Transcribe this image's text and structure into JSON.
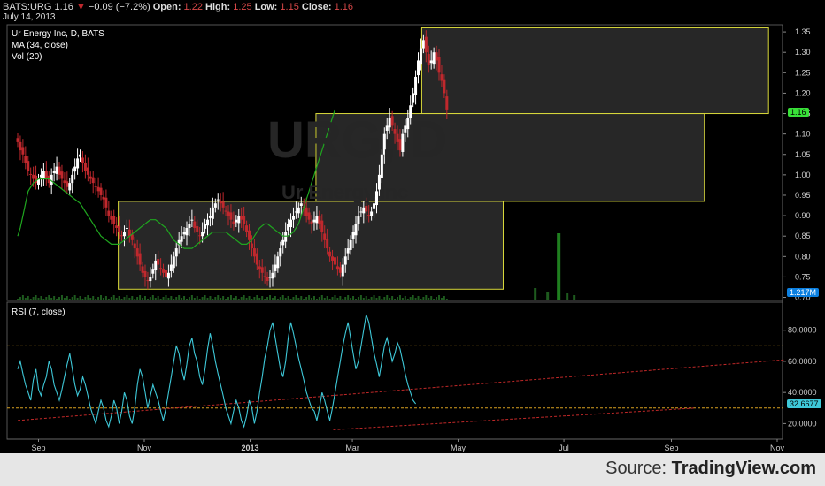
{
  "header": {
    "symbol": "BATS:URG",
    "last": "1.16",
    "change": "−0.09 (−7.2%)",
    "open_label": "Open:",
    "open": "1.22",
    "high_label": "High:",
    "high": "1.25",
    "low_label": "Low:",
    "low": "1.15",
    "close_label": "Close:",
    "close": "1.16",
    "date": "July 14, 2013"
  },
  "legend": {
    "title": "Ur Energy Inc, D, BATS",
    "ma": "MA (34, close)",
    "vol": "Vol (20)",
    "rsi": "RSI (7, close)"
  },
  "watermark": {
    "symbol": "URG, D",
    "name": "Ur Energy Inc"
  },
  "source": {
    "prefix": "Source: ",
    "brand": "TradingView.com"
  },
  "colors": {
    "up": "#ffffff",
    "down": "#c0282d",
    "ma": "#1fa61f",
    "rsi": "#3ec8d8",
    "box": "#d8d83a",
    "level": "#d8a020",
    "trend": "#c02828",
    "price_tag": "#38e038",
    "vol_tag": "#0b7fe0"
  },
  "chart_data": {
    "type": "candlestick",
    "price_axis": {
      "ticks": [
        "0.70",
        "0.75",
        "0.80",
        "0.85",
        "0.90",
        "0.95",
        "1.00",
        "1.05",
        "1.10",
        "1.15",
        "1.20",
        "1.25",
        "1.30",
        "1.35"
      ],
      "last_price": "1.16"
    },
    "volume": {
      "last": "1.217M",
      "spike_value_fraction": 0.95
    },
    "time_axis": {
      "ticks": [
        "Sep",
        "Nov",
        "2013",
        "Mar",
        "May",
        "Jul",
        "Sep",
        "Nov"
      ]
    },
    "rsi": {
      "ticks": [
        "20.0000",
        "40.0000",
        "60.0000",
        "80.0000"
      ],
      "last": "32.6677",
      "levels": [
        70,
        30
      ]
    },
    "boxes": [
      {
        "x_start": "2012-10-17",
        "x_end": "2013-05-27",
        "low": 0.72,
        "high": 0.935
      },
      {
        "x_start": "2013-02-08",
        "x_end": "2013-09-20",
        "low": 0.935,
        "high": 1.15
      },
      {
        "x_start": "2013-04-10",
        "x_end": "2013-10-27",
        "low": 1.15,
        "high": 1.36
      }
    ],
    "price_series": {
      "x_start": "2012-08-20",
      "step_days": 1.5,
      "closes": [
        1.08,
        1.06,
        1.05,
        1.03,
        1.01,
        1.0,
        0.99,
        0.98,
        0.99,
        1.0,
        1.01,
        0.99,
        0.98,
        1.0,
        1.01,
        1.02,
        1.0,
        0.99,
        0.98,
        0.97,
        0.98,
        1.0,
        1.02,
        1.04,
        1.05,
        1.03,
        1.01,
        1.0,
        0.99,
        0.98,
        0.97,
        0.96,
        0.95,
        0.94,
        0.92,
        0.9,
        0.89,
        0.88,
        0.87,
        0.86,
        0.85,
        0.86,
        0.87,
        0.85,
        0.84,
        0.82,
        0.8,
        0.78,
        0.76,
        0.75,
        0.74,
        0.75,
        0.77,
        0.79,
        0.78,
        0.77,
        0.76,
        0.75,
        0.76,
        0.78,
        0.8,
        0.82,
        0.84,
        0.85,
        0.86,
        0.87,
        0.88,
        0.89,
        0.87,
        0.86,
        0.85,
        0.86,
        0.88,
        0.89,
        0.9,
        0.92,
        0.93,
        0.94,
        0.93,
        0.92,
        0.91,
        0.9,
        0.89,
        0.88,
        0.89,
        0.9,
        0.89,
        0.88,
        0.86,
        0.84,
        0.82,
        0.8,
        0.78,
        0.77,
        0.76,
        0.75,
        0.74,
        0.75,
        0.76,
        0.78,
        0.8,
        0.82,
        0.84,
        0.86,
        0.88,
        0.89,
        0.9,
        0.91,
        0.92,
        0.93,
        0.92,
        0.9,
        0.89,
        0.88,
        0.89,
        0.9,
        0.88,
        0.86,
        0.84,
        0.82,
        0.8,
        0.79,
        0.78,
        0.77,
        0.76,
        0.78,
        0.8,
        0.82,
        0.84,
        0.86,
        0.88,
        0.9,
        0.91,
        0.92,
        0.91,
        0.9,
        0.91,
        0.93,
        0.96,
        1.0,
        1.05,
        1.1,
        1.12,
        1.14,
        1.12,
        1.1,
        1.08,
        1.06,
        1.1,
        1.12,
        1.14,
        1.17,
        1.2,
        1.24,
        1.28,
        1.31,
        1.33,
        1.3,
        1.27,
        1.28,
        1.3,
        1.28,
        1.25,
        1.23,
        1.2,
        1.16
      ]
    },
    "ma_series": {
      "x_start": "2012-08-20",
      "step_days": 1.5,
      "values": [
        0.85,
        0.87,
        0.9,
        0.93,
        0.96,
        0.97,
        0.98,
        0.985,
        0.99,
        0.99,
        0.99,
        0.99,
        0.99,
        0.985,
        0.98,
        0.975,
        0.97,
        0.965,
        0.96,
        0.955,
        0.95,
        0.945,
        0.94,
        0.935,
        0.93,
        0.92,
        0.91,
        0.9,
        0.89,
        0.88,
        0.87,
        0.86,
        0.85,
        0.845,
        0.84,
        0.835,
        0.83,
        0.83,
        0.83,
        0.83,
        0.835,
        0.84,
        0.845,
        0.85,
        0.855,
        0.86,
        0.865,
        0.87,
        0.875,
        0.88,
        0.885,
        0.89,
        0.89,
        0.89,
        0.885,
        0.88,
        0.875,
        0.87,
        0.86,
        0.85,
        0.84,
        0.835,
        0.83,
        0.825,
        0.82,
        0.82,
        0.82,
        0.82,
        0.825,
        0.83,
        0.835,
        0.84,
        0.845,
        0.85,
        0.855,
        0.86,
        0.86,
        0.86,
        0.86,
        0.86,
        0.86,
        0.855,
        0.85,
        0.845,
        0.84,
        0.835,
        0.83,
        0.83,
        0.83,
        0.835,
        0.84,
        0.85,
        0.86,
        0.87,
        0.875,
        0.88,
        0.88,
        0.875,
        0.87,
        0.865,
        0.86,
        0.855,
        0.85,
        0.85,
        0.85,
        0.855,
        0.86,
        0.87,
        0.88,
        0.9,
        0.92,
        0.94,
        0.96,
        0.98,
        1.0,
        1.02,
        1.04,
        1.06,
        1.08,
        1.1,
        1.12,
        1.14,
        1.16
      ]
    },
    "rsi_series": {
      "x_start": "2012-08-20",
      "step_days": 1.5,
      "values": [
        55,
        60,
        52,
        45,
        40,
        35,
        48,
        55,
        42,
        38,
        45,
        50,
        60,
        55,
        45,
        40,
        35,
        42,
        50,
        58,
        65,
        55,
        45,
        38,
        42,
        50,
        45,
        38,
        30,
        25,
        20,
        28,
        35,
        30,
        22,
        18,
        25,
        35,
        30,
        20,
        28,
        40,
        35,
        25,
        20,
        30,
        45,
        55,
        50,
        40,
        30,
        38,
        45,
        40,
        35,
        28,
        22,
        30,
        40,
        50,
        60,
        70,
        65,
        55,
        48,
        58,
        70,
        75,
        65,
        60,
        50,
        45,
        55,
        68,
        78,
        70,
        60,
        52,
        45,
        38,
        30,
        25,
        20,
        28,
        35,
        30,
        22,
        18,
        25,
        35,
        30,
        20,
        28,
        40,
        50,
        62,
        70,
        80,
        85,
        75,
        65,
        55,
        50,
        60,
        75,
        85,
        78,
        70,
        62,
        55,
        48,
        40,
        35,
        30,
        28,
        22,
        30,
        40,
        35,
        28,
        22,
        30,
        40,
        50,
        60,
        70,
        78,
        85,
        75,
        65,
        55,
        60,
        70,
        80,
        90,
        85,
        75,
        65,
        58,
        50,
        60,
        70,
        75,
        68,
        60,
        65,
        72,
        68,
        60,
        52,
        45,
        40,
        35,
        32.7
      ]
    },
    "rsi_trendlines": [
      {
        "from": [
          "2012-08-20",
          22
        ],
        "to": [
          "2013-11-05",
          61
        ]
      },
      {
        "from": [
          "2013-02-18",
          16
        ],
        "to": [
          "2013-09-15",
          30
        ]
      }
    ]
  }
}
